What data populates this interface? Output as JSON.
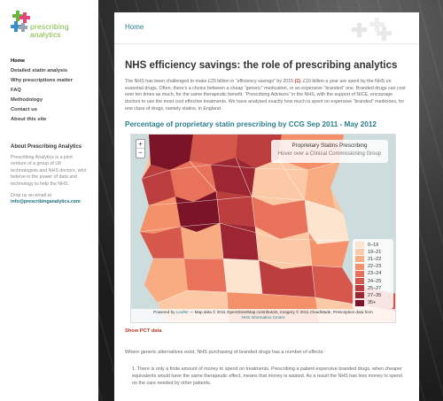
{
  "sidebar": {
    "logo": {
      "line1": "prescribing",
      "line2": "analytics"
    },
    "nav": [
      {
        "label": "Home",
        "active": true
      },
      {
        "label": "Detailed statin analysis",
        "active": false
      },
      {
        "label": "Why prescriptions matter",
        "active": false
      },
      {
        "label": "FAQ",
        "active": false
      },
      {
        "label": "Methodology",
        "active": false
      },
      {
        "label": "Contact us",
        "active": false
      },
      {
        "label": "About this site",
        "active": false
      }
    ],
    "about_title": "About Prescribing Analytics",
    "about_text": "Prescribing Analytics is a joint venture of a group of UK technologists and NHS doctors, who believe in the power of data and technology to help the NHS.",
    "drop_text": "Drop us an email at",
    "email": "info@prescribinganalytics.com"
  },
  "main": {
    "breadcrumb": "Home",
    "title": "NHS efficiency savings: the role of prescribing analytics",
    "intro_a": "The NHS has been challenged to make £20 billion in “efficiency savings” by 2015 ",
    "intro_ref": "(1)",
    "intro_b": ". £10 billion a year are spent by the NHS on essential drugs. Often, there’s a choice between a cheap “generic” medication, or an expensive “branded” one. Branded drugs can cost over ten times as much, for the same therapeutic benefit. “Prescribing Advisors” in the NHS, with the support of NICE, encourage doctors to use the most cost effective treatments. We have analysed exactly how much is spent on expensive “branded” medicines, for one class of drugs, namely statins, in England.",
    "map_title": "Percentage of proprietary statin prescribing by CCG Sep 2011 - May 2012",
    "map": {
      "zoom_in": "+",
      "zoom_out": "−",
      "info_title": "Proprietary Statins Prescribing",
      "info_sub": "Hover over a Clinical Commissioning Group",
      "legend": [
        {
          "label": "0–19",
          "color": "#fde4cf"
        },
        {
          "label": "19–21",
          "color": "#fcc9a6"
        },
        {
          "label": "21–22",
          "color": "#f9ac82"
        },
        {
          "label": "22–23",
          "color": "#f4906a"
        },
        {
          "label": "23–24",
          "color": "#e8735a"
        },
        {
          "label": "24–25",
          "color": "#d6574c"
        },
        {
          "label": "25–27",
          "color": "#bb3d3e"
        },
        {
          "label": "27–35",
          "color": "#9c2632"
        },
        {
          "label": "35+",
          "color": "#7a1426"
        }
      ],
      "attribution_a": "Powered by ",
      "attribution_leaflet": "Leaflet",
      "attribution_b": " — Map data © 2011 OpenStreetMap contributors, Imagery © 2011 CloudMade, Prescription data from",
      "attribution_nhs": "NHS Information Centre"
    },
    "show_pct": "Show PCT data",
    "body": "Where generic alternatives exist, NHS purchasing of branded drugs has a number of effects:",
    "list_1": "1. There is only a finite amount of money to spend on treatments. Prescribing a patient expensive branded drugs, when cheaper equivalents would have the same therapeutic effect, means that money is wasted. As a result the NHS has less money to spend on the care needed by other patients."
  }
}
